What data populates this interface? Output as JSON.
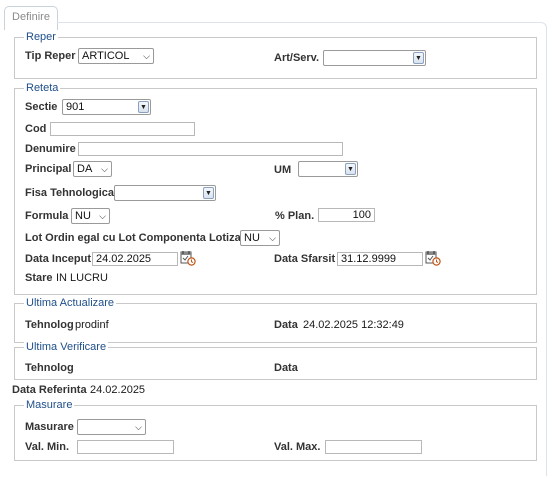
{
  "tab": {
    "label": "Definire"
  },
  "reper": {
    "legend": "Reper",
    "tip_label": "Tip Reper",
    "tip_value": "ARTICOL",
    "artserv_label": "Art/Serv.",
    "artserv_value": ""
  },
  "reteta": {
    "legend": "Reteta",
    "sectie_label": "Sectie",
    "sectie_value": "901",
    "cod_label": "Cod",
    "cod_value": "",
    "denumire_label": "Denumire",
    "denumire_value": "",
    "principal_label": "Principal",
    "principal_value": "DA",
    "um_label": "UM",
    "um_value": "",
    "fisa_label": "Fisa Tehnologica",
    "fisa_value": "",
    "formula_label": "Formula",
    "formula_value": "NU",
    "plan_label": "% Plan.",
    "plan_value": "100",
    "lot_label": "Lot Ordin egal cu Lot Componenta Lotizata",
    "lot_value": "NU",
    "data_inceput_label": "Data Inceput",
    "data_inceput_value": "24.02.2025",
    "data_sfarsit_label": "Data Sfarsit",
    "data_sfarsit_value": "31.12.9999",
    "stare_label": "Stare",
    "stare_value": "IN LUCRU"
  },
  "ultima_actualizare": {
    "legend": "Ultima Actualizare",
    "tehnolog_label": "Tehnolog",
    "tehnolog_value": "prodinf",
    "data_label": "Data",
    "data_value": "24.02.2025 12:32:49"
  },
  "ultima_verificare": {
    "legend": "Ultima Verificare",
    "tehnolog_label": "Tehnolog",
    "data_label": "Data"
  },
  "data_referinta": {
    "label": "Data Referinta",
    "value": "24.02.2025"
  },
  "masurare": {
    "legend": "Masurare",
    "masurare_label": "Masurare",
    "masurare_value": "",
    "valmin_label": "Val. Min.",
    "valmin_value": "",
    "valmax_label": "Val. Max.",
    "valmax_value": ""
  },
  "icons": [
    "chevron-down-icon",
    "calendar-clock-icon"
  ]
}
